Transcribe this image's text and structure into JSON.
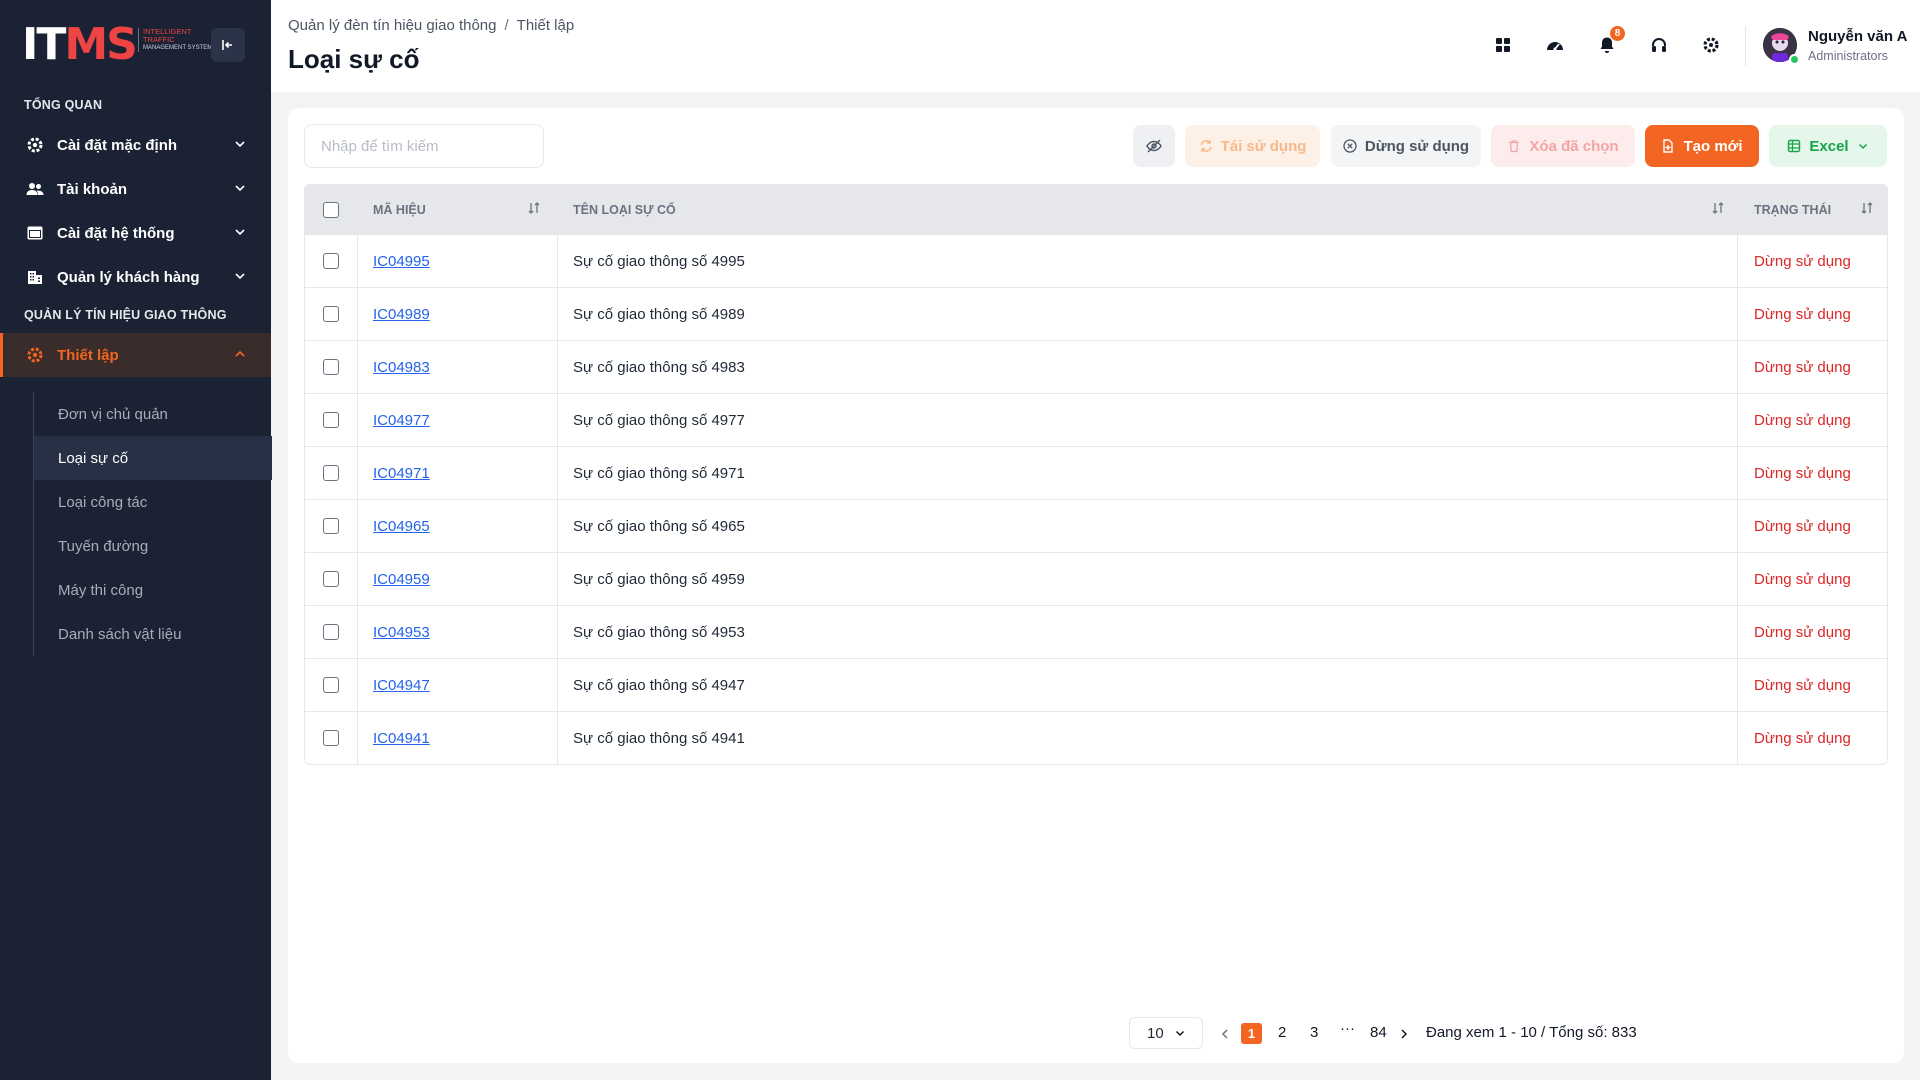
{
  "brand": {
    "logo_text_1": "IT",
    "logo_text_2": "MS",
    "logo_tag_1": "Intelligent",
    "logo_tag_2": "Traffic",
    "logo_tag_3": "Management System"
  },
  "sidebar": {
    "section_overview": "TỔNG QUAN",
    "items": [
      {
        "label": "Cài đặt mặc định",
        "icon": "gear-icon"
      },
      {
        "label": "Tài khoản",
        "icon": "users-icon"
      },
      {
        "label": "Cài đặt hệ thống",
        "icon": "window-icon"
      },
      {
        "label": "Quản lý khách hàng",
        "icon": "building-icon"
      }
    ],
    "section_traffic": "QUẢN LÝ TÍN HIỆU GIAO THÔNG",
    "active_group": {
      "label": "Thiết lập",
      "icon": "gear-icon"
    },
    "sub_items": [
      {
        "label": "Đơn vị chủ quản"
      },
      {
        "label": "Loại sự cố"
      },
      {
        "label": "Loại công tác"
      },
      {
        "label": "Tuyến đường"
      },
      {
        "label": "Máy thi công"
      },
      {
        "label": "Danh sách vật liệu"
      }
    ],
    "active_sub": "Loại sự cố"
  },
  "header": {
    "breadcrumb": [
      "Quản lý đèn tín hiệu giao thông",
      "/",
      "Thiết lập"
    ],
    "title": "Loại sự cố",
    "notification_count": "8",
    "user_name": "Nguyễn văn A",
    "user_role": "Administrators"
  },
  "toolbar": {
    "search_placeholder": "Nhập để tìm kiếm",
    "reuse_label": "Tái sử dụng",
    "stop_label": "Dừng sử dụng",
    "delete_label": "Xóa đã chọn",
    "create_label": "Tạo mới",
    "excel_label": "Excel"
  },
  "table": {
    "columns": [
      "MÃ HIỆU",
      "TÊN LOẠI SỰ CỐ",
      "TRẠNG THÁI"
    ],
    "rows": [
      {
        "code": "IC04995",
        "name": "Sự cố giao thông số 4995",
        "status": "Dừng sử dụng"
      },
      {
        "code": "IC04989",
        "name": "Sự cố giao thông số 4989",
        "status": "Dừng sử dụng"
      },
      {
        "code": "IC04983",
        "name": "Sự cố giao thông số 4983",
        "status": "Dừng sử dụng"
      },
      {
        "code": "IC04977",
        "name": "Sự cố giao thông số 4977",
        "status": "Dừng sử dụng"
      },
      {
        "code": "IC04971",
        "name": "Sự cố giao thông số 4971",
        "status": "Dừng sử dụng"
      },
      {
        "code": "IC04965",
        "name": "Sự cố giao thông số 4965",
        "status": "Dừng sử dụng"
      },
      {
        "code": "IC04959",
        "name": "Sự cố giao thông số 4959",
        "status": "Dừng sử dụng"
      },
      {
        "code": "IC04953",
        "name": "Sự cố giao thông số 4953",
        "status": "Dừng sử dụng"
      },
      {
        "code": "IC04947",
        "name": "Sự cố giao thông số 4947",
        "status": "Dừng sử dụng"
      },
      {
        "code": "IC04941",
        "name": "Sự cố giao thông số 4941",
        "status": "Dừng sử dụng"
      }
    ]
  },
  "pagination": {
    "page_size": "10",
    "pages": [
      "1",
      "2",
      "3",
      "···",
      "84"
    ],
    "current": "1",
    "info": "Đang xem 1 - 10 / Tổng số: 833"
  },
  "colors": {
    "accent": "#f26522",
    "sidebar_bg": "#1b2233",
    "status_stopped": "#dc2626",
    "link": "#2563eb",
    "excel": "#16a34a"
  }
}
